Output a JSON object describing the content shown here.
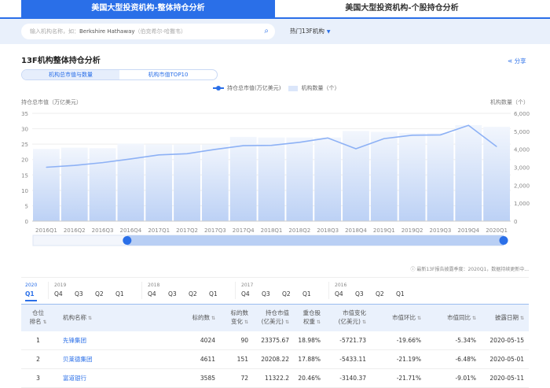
{
  "top_tabs": [
    "美国大型投资机构-整体持仓分析",
    "美国大型投资机构-个股持仓分析"
  ],
  "search": {
    "placeholder_prefix": "输入机构名称，如：",
    "placeholder_example": "Berkshire Hathaway",
    "placeholder_suffix": "（伯克希尔-哈撒韦）",
    "hot_label": "热门13F机构"
  },
  "section_title": "13F机构整体持仓分析",
  "share_label": "分享",
  "view_tabs": [
    "机构总市值与数量",
    "机构市值TOP10"
  ],
  "chart_data": {
    "type": "bar+line",
    "legend": [
      "持仓总市值(万亿美元)",
      "机构数量（个）"
    ],
    "ylabel_left": "持仓总市值（万亿美元）",
    "ylabel_right": "机构数量（个）",
    "ylim_left": [
      0,
      35
    ],
    "yticks_left": [
      "0",
      "5",
      "10",
      "15",
      "20",
      "25",
      "30",
      "35"
    ],
    "ylim_right": [
      0,
      6000
    ],
    "yticks_right": [
      "0",
      "1,000",
      "2,000",
      "3,000",
      "4,000",
      "5,000",
      "6,000"
    ],
    "categories": [
      "2016Q1",
      "2016Q2",
      "2016Q3",
      "2016Q4",
      "2017Q1",
      "2017Q2",
      "2017Q3",
      "2017Q4",
      "2018Q1",
      "2018Q2",
      "2018Q3",
      "2018Q4",
      "2019Q1",
      "2019Q2",
      "2019Q3",
      "2019Q4",
      "2020Q1"
    ],
    "series": [
      {
        "name": "机构数量（个）",
        "type": "bar",
        "axis": "right",
        "values": [
          4020,
          4090,
          4060,
          4310,
          4280,
          4280,
          4270,
          4690,
          4660,
          4660,
          4660,
          5020,
          4970,
          4910,
          4910,
          5340,
          5250
        ]
      },
      {
        "name": "持仓总市值(万亿美元)",
        "type": "line",
        "axis": "left",
        "values": [
          17.5,
          18.1,
          19.0,
          20.2,
          21.5,
          21.9,
          23.3,
          24.5,
          24.6,
          25.6,
          27.0,
          23.5,
          26.8,
          27.9,
          28.0,
          31.1,
          24.2
        ]
      }
    ],
    "zoom_range_percent": [
      20,
      100
    ]
  },
  "note": "ⓘ 最新13F报告披露季度：2020Q1，数据持续更新中...",
  "quarters": [
    {
      "year": "2020",
      "qs": [
        "Q1"
      ]
    },
    {
      "year": "2019",
      "qs": [
        "Q4",
        "Q3",
        "Q2",
        "Q1"
      ]
    },
    {
      "year": "2018",
      "qs": [
        "Q4",
        "Q3",
        "Q2",
        "Q1"
      ]
    },
    {
      "year": "2017",
      "qs": [
        "Q4",
        "Q3",
        "Q2",
        "Q1"
      ]
    },
    {
      "year": "2016",
      "qs": [
        "Q4",
        "Q3",
        "Q2",
        "Q1"
      ]
    }
  ],
  "table": {
    "headers": [
      [
        "仓位",
        "排名"
      ],
      [
        "机构名称"
      ],
      [
        "标的数"
      ],
      [
        "标的数",
        "变化"
      ],
      [
        "持仓市值",
        "(亿美元)"
      ],
      [
        "重仓股",
        "权重"
      ],
      [
        "市值变化",
        "(亿美元)"
      ],
      [
        "市值环比"
      ],
      [
        "市值同比"
      ],
      [
        "披露日期"
      ]
    ],
    "rows": [
      [
        "1",
        "先锋集团",
        "4024",
        "90",
        "23375.67",
        "18.98%",
        "-5721.73",
        "-19.66%",
        "-5.34%",
        "2020-05-15"
      ],
      [
        "2",
        "贝莱德集团",
        "4611",
        "151",
        "20208.22",
        "17.88%",
        "-5433.11",
        "-21.19%",
        "-6.48%",
        "2020-05-01"
      ],
      [
        "3",
        "富道银行",
        "3585",
        "72",
        "11322.2",
        "20.46%",
        "-3140.37",
        "-21.71%",
        "-9.01%",
        "2020-05-11"
      ]
    ]
  }
}
